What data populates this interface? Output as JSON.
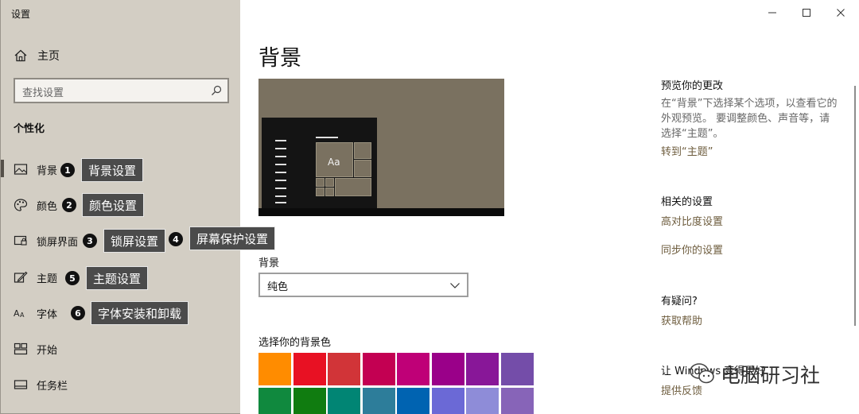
{
  "window": {
    "title": "设置",
    "controls": [
      "minimize-icon",
      "maximize-icon",
      "close-icon"
    ]
  },
  "sidebar": {
    "home": {
      "label": "主页",
      "icon": "home-icon"
    },
    "search": {
      "placeholder": "查找设置",
      "icon": "search-icon"
    },
    "section": "个性化",
    "items": [
      {
        "label": "背景",
        "icon": "picture-icon",
        "selected": true
      },
      {
        "label": "颜色",
        "icon": "palette-icon"
      },
      {
        "label": "锁屏界面",
        "icon": "lock-screen-icon"
      },
      {
        "label": "主题",
        "icon": "theme-pen-icon"
      },
      {
        "label": "字体",
        "icon": "font-icon"
      },
      {
        "label": "开始",
        "icon": "start-tiles-icon"
      },
      {
        "label": "任务栏",
        "icon": "taskbar-icon"
      }
    ]
  },
  "annotations": [
    {
      "number": "1",
      "text": "背景设置"
    },
    {
      "number": "2",
      "text": "颜色设置"
    },
    {
      "number": "3",
      "text": "锁屏设置"
    },
    {
      "number": "4",
      "text": "屏幕保护设置"
    },
    {
      "number": "5",
      "text": "主题设置"
    },
    {
      "number": "6",
      "text": "字体安装和卸载"
    }
  ],
  "main": {
    "title": "背景",
    "preview_tile_text": "Aa",
    "background_label": "背景",
    "background_value": "纯色",
    "color_label": "选择你的背景色",
    "swatches": [
      "#ff8c00",
      "#e81123",
      "#d13438",
      "#c30052",
      "#bf0077",
      "#9a0089",
      "#881798",
      "#744da9",
      "#10893e",
      "#107c10",
      "#018574",
      "#2d7d9a",
      "#0063b1",
      "#6b69d6",
      "#8e8cd8",
      "#8764b8"
    ]
  },
  "right": {
    "preview_heading": "预览你的更改",
    "preview_text": "在“背景”下选择某个选项，以查看它的外观预览。 要调整颜色、声音等，请选择“主题”。",
    "preview_link": "转到“主题”",
    "related_heading": "相关的设置",
    "related_links": [
      "高对比度设置",
      "同步你的设置"
    ],
    "question_heading": "有疑问?",
    "help_link": "获取帮助",
    "feedback_heading": "让 Windows 变得更好",
    "feedback_link": "提供反馈"
  },
  "watermark": {
    "text": "电脑研习社",
    "icon": "wechat-icon"
  }
}
